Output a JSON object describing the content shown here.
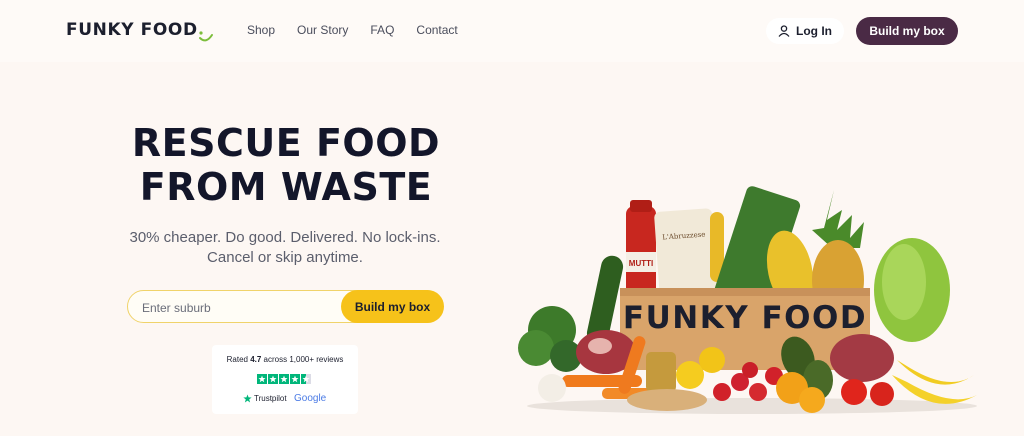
{
  "brand": {
    "name": "FUNKY FOOD"
  },
  "nav": {
    "items": [
      "Shop",
      "Our Story",
      "FAQ",
      "Contact"
    ]
  },
  "header": {
    "login_label": "Log In",
    "build_label": "Build my box"
  },
  "hero": {
    "title_line1": "RESCUE FOOD",
    "title_line2": "FROM WASTE",
    "subtitle_line1": "30% cheaper. Do good. Delivered. No lock-ins.",
    "subtitle_line2": "Cancel or skip anytime.",
    "search_placeholder": "Enter suburb",
    "cta_label": "Build my box"
  },
  "reviews": {
    "prefix": "Rated ",
    "rating": "4.7",
    "suffix": " across 1,000+ reviews",
    "stars": 4.5,
    "trustpilot_label": "Trustpilot",
    "google_label": "Google"
  },
  "box": {
    "label": "FUNKY FOOD",
    "sauce_label": "MUTTI",
    "pasta_label": "L'Abruzzese"
  },
  "colors": {
    "background": "#fdf7f3",
    "primary_dark": "#4a2a45",
    "accent_yellow": "#f6c21a",
    "trustpilot_green": "#00b67a"
  }
}
